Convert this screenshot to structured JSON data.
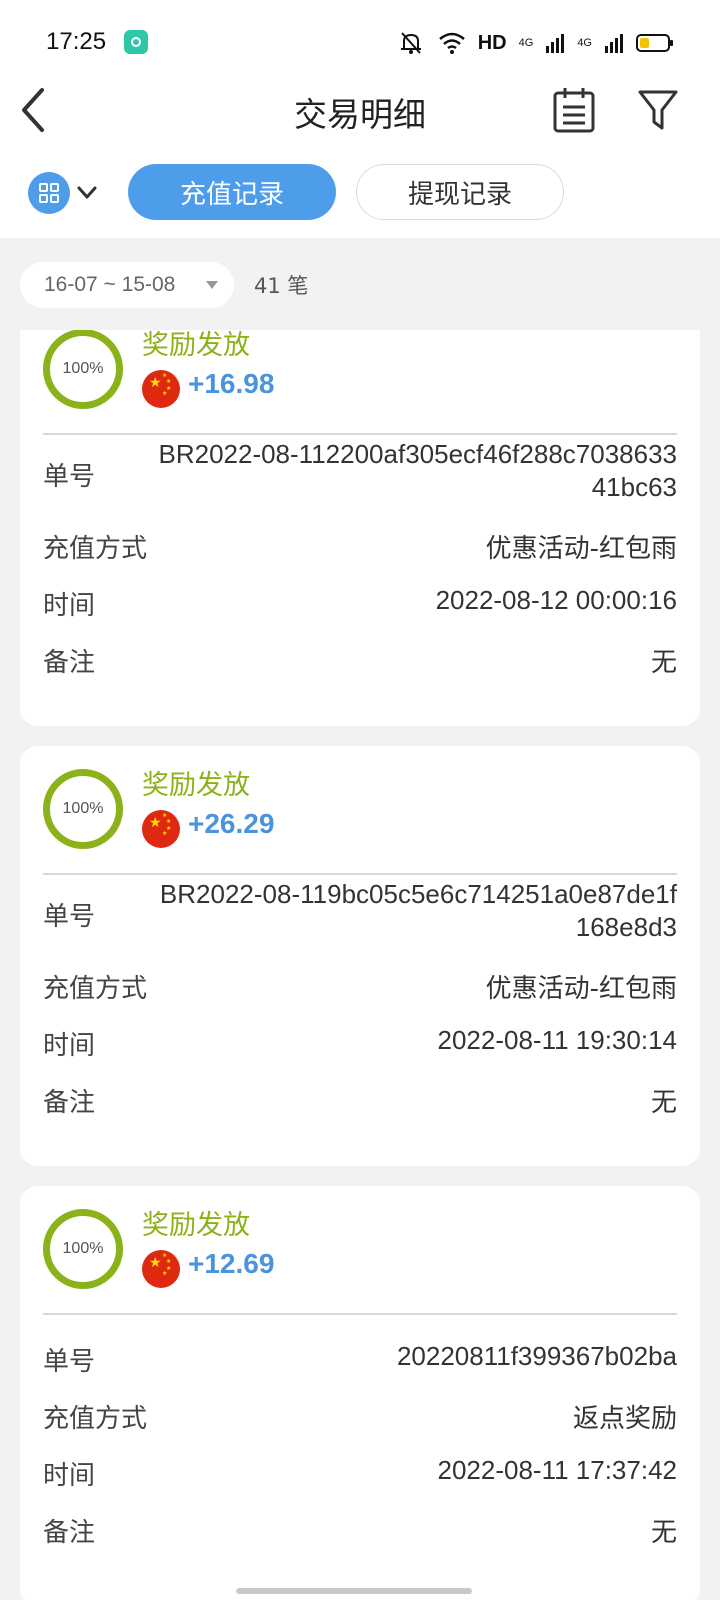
{
  "status_bar": {
    "time": "17:25",
    "network": "HD",
    "sig1": "4G",
    "sig2": "4G"
  },
  "header": {
    "title": "交易明细"
  },
  "tabs": {
    "deposit": "充值记录",
    "withdraw": "提现记录"
  },
  "filter": {
    "date_range": "16-07 ~ 15-08",
    "count": "41 笔"
  },
  "labels": {
    "order_no": "单号",
    "method": "充值方式",
    "time": "时间",
    "note": "备注"
  },
  "records": [
    {
      "progress": "100%",
      "title": "奖励发放",
      "amount": "+16.98",
      "order_no": "BR2022-08-112200af305ecf46f288c703863341bc63",
      "method": "优惠活动-红包雨",
      "time": "2022-08-12 00:00:16",
      "note": "无"
    },
    {
      "progress": "100%",
      "title": "奖励发放",
      "amount": "+26.29",
      "order_no": "BR2022-08-119bc05c5e6c714251a0e87de1f168e8d3",
      "method": "优惠活动-红包雨",
      "time": "2022-08-11 19:30:14",
      "note": "无"
    },
    {
      "progress": "100%",
      "title": "奖励发放",
      "amount": "+12.69",
      "order_no": "20220811f399367b02ba",
      "method": "返点奖励",
      "time": "2022-08-11 17:37:42",
      "note": "无"
    }
  ],
  "colors": {
    "accent": "#4e9deb",
    "success": "#8cb21a",
    "amount": "#4a93df"
  }
}
